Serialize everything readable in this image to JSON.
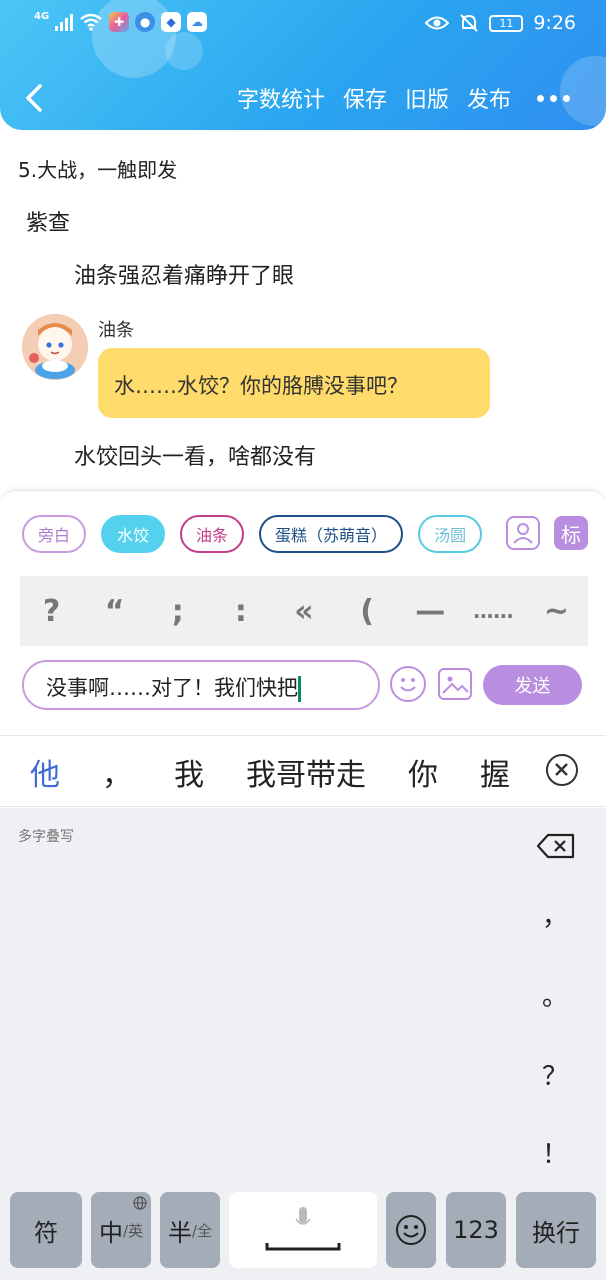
{
  "status_bar": {
    "network": "4G",
    "time": "9:26",
    "battery": "11"
  },
  "nav": {
    "actions": [
      "字数统计",
      "保存",
      "旧版",
      "发布"
    ]
  },
  "content": {
    "chapter_title": "5.大战，一触即发",
    "lines": [
      "紫查",
      "油条强忍着痛睁开了眼"
    ],
    "message": {
      "speaker": "油条",
      "text": "水……水饺？你的胳膊没事吧？"
    },
    "narration_after": "水饺回头一看，啥都没有"
  },
  "editor": {
    "role_chips": [
      "旁白",
      "水饺",
      "油条",
      "蛋糕（苏萌音）",
      "汤圆"
    ],
    "tag_label": "标",
    "punctuation": [
      "?",
      "“",
      ";",
      ":",
      "«",
      "(",
      "—",
      "……",
      "~"
    ],
    "input_value": "没事啊……对了！我们快把",
    "send_label": "发送"
  },
  "ime": {
    "candidates": [
      "他",
      "，",
      "我",
      "我哥带走",
      "你",
      "握"
    ],
    "hint": "多字叠写",
    "side_punct": [
      "，",
      "。",
      "？",
      "！"
    ],
    "keys": {
      "symbol": "符",
      "zh": "中",
      "zh_sub": "/英",
      "half": "半",
      "half_sub": "/全",
      "num": "123",
      "enter": "换行"
    }
  },
  "colors": {
    "header_gradient_start": "#4cc6f5",
    "header_gradient_end": "#2f8ff0",
    "bubble": "#fedb6a",
    "accent": "#b98ee0"
  }
}
